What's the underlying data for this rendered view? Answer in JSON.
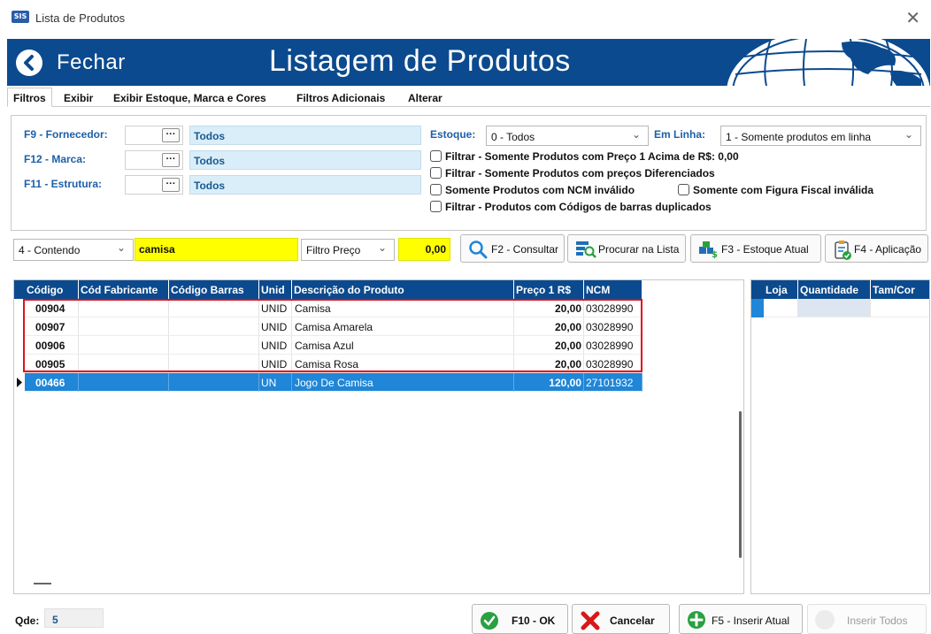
{
  "window": {
    "title": "Lista de Produtos",
    "app_icon_text": "SIS"
  },
  "header": {
    "back_label": "Fechar",
    "page_title": "Listagem de Produtos"
  },
  "tabs": [
    {
      "label": "Filtros"
    },
    {
      "label": "Exibir"
    },
    {
      "label": "Exibir Estoque, Marca e Cores"
    },
    {
      "label": "Filtros Adicionais"
    },
    {
      "label": "Alterar"
    }
  ],
  "filters": {
    "fornecedor": {
      "label": "F9 - Fornecedor:",
      "value": "Todos"
    },
    "marca": {
      "label": "F12 - Marca:",
      "value": "Todos"
    },
    "estrutura": {
      "label": "F11 - Estrutura:",
      "value": "Todos"
    },
    "ellipsis": "···",
    "estoque": {
      "label": "Estoque:",
      "value": "0 - Todos"
    },
    "em_linha": {
      "label": "Em Linha:",
      "value": "1 - Somente produtos em linha"
    },
    "checks": [
      "Filtrar - Somente Produtos com Preço 1 Acima de R$: 0,00",
      "Filtrar - Somente Produtos com preços Diferenciados",
      "Somente Produtos com NCM inválido",
      "Somente com Figura Fiscal inválida",
      "Filtrar - Produtos com Códigos de barras duplicados"
    ]
  },
  "search": {
    "mode": "4 - Contendo",
    "term": "camisa",
    "price_filter": "Filtro Preço",
    "price_value": "0,00",
    "btn_consultar": "F2 - Consultar",
    "btn_procurar": "Procurar na Lista",
    "btn_estoque": "F3 - Estoque Atual",
    "btn_aplicacao": "F4 - Aplicação"
  },
  "grid": {
    "columns": [
      "Código",
      "Cód Fabricante",
      "Código Barras",
      "Unid",
      "Descrição do Produto",
      "Preço 1 R$",
      "NCM"
    ],
    "rows": [
      {
        "codigo": "00904",
        "fab": "",
        "barras": "",
        "unid": "UNID",
        "desc": "Camisa",
        "preco": "20,00",
        "ncm": "03028990"
      },
      {
        "codigo": "00907",
        "fab": "",
        "barras": "",
        "unid": "UNID",
        "desc": "Camisa Amarela",
        "preco": "20,00",
        "ncm": "03028990"
      },
      {
        "codigo": "00906",
        "fab": "",
        "barras": "",
        "unid": "UNID",
        "desc": "Camisa Azul",
        "preco": "20,00",
        "ncm": "03028990"
      },
      {
        "codigo": "00905",
        "fab": "",
        "barras": "",
        "unid": "UNID",
        "desc": "Camisa Rosa",
        "preco": "20,00",
        "ncm": "03028990"
      },
      {
        "codigo": "00466",
        "fab": "",
        "barras": "",
        "unid": "UN",
        "desc": "Jogo De Camisa",
        "preco": "120,00",
        "ncm": "27101932"
      }
    ],
    "selected_row": 4
  },
  "stock_grid": {
    "columns": [
      "Loja",
      "Quantidade",
      "Tam/Cor"
    ]
  },
  "footer": {
    "qde_label": "Qde:",
    "qde_value": "5",
    "btn_ok": "F10 - OK",
    "btn_cancelar": "Cancelar",
    "btn_inserir_atual": "F5 - Inserir Atual",
    "btn_inserir_todos": "Inserir Todos"
  },
  "colors": {
    "header_blue": "#0b4a8e",
    "selection_blue": "#1f86d8",
    "highlight_red": "#e0101a",
    "search_yellow": "#ffff00"
  }
}
